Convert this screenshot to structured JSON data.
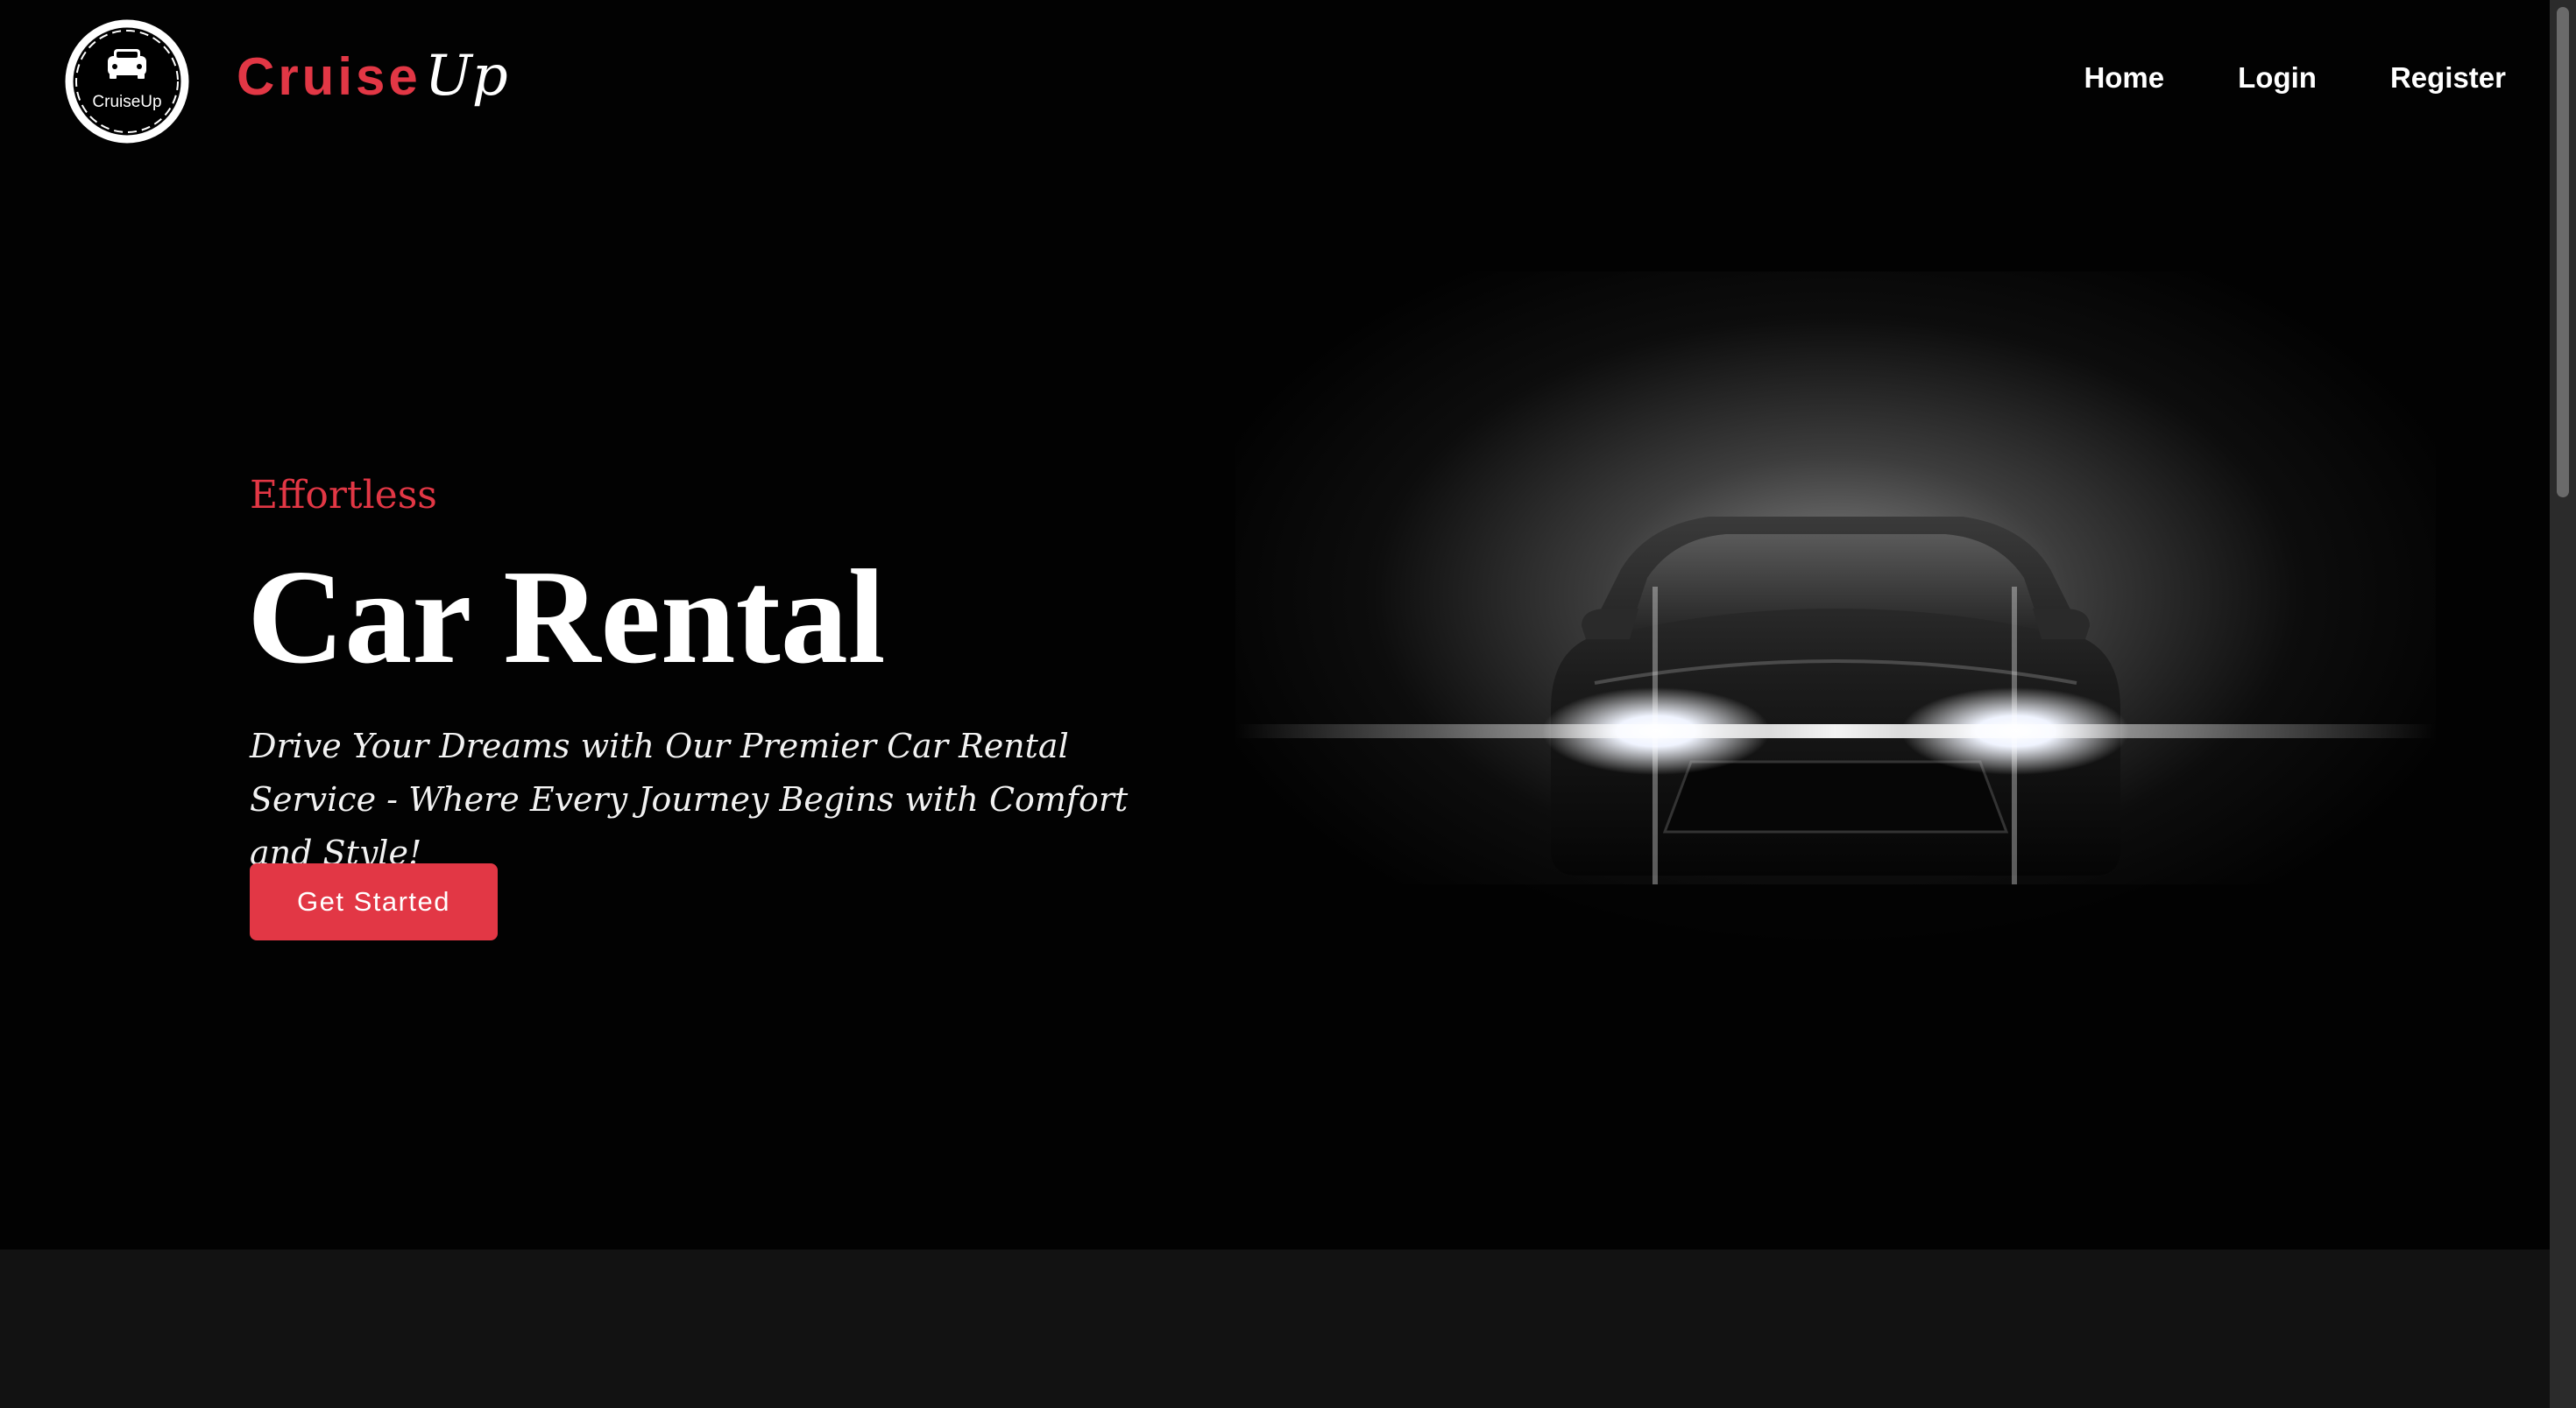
{
  "header": {
    "logo_text": "CruiseUp",
    "brand_first": "Cruise",
    "brand_second": "Up",
    "nav": [
      {
        "label": "Home"
      },
      {
        "label": "Login"
      },
      {
        "label": "Register"
      }
    ]
  },
  "hero": {
    "eyebrow": "Effortless",
    "title": "Car Rental",
    "subtitle": "Drive Your Dreams with Our Premier Car Rental Service - Where Every Journey Begins with Comfort and Style!",
    "cta_label": "Get Started"
  },
  "colors": {
    "accent": "#e23745",
    "background": "#020202",
    "lower_section": "#121212"
  }
}
